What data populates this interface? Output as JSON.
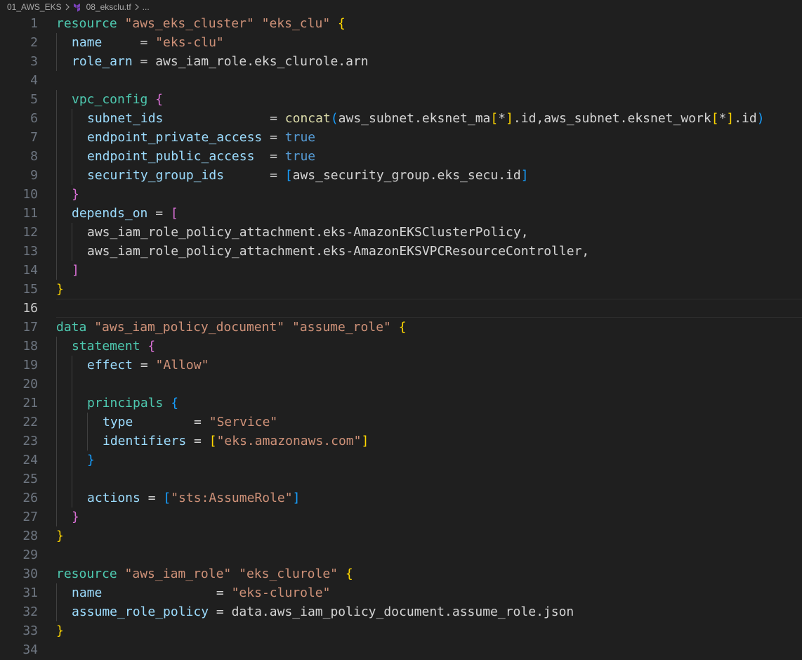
{
  "breadcrumb": {
    "folder": "01_AWS_EKS",
    "file": "08_eksclu.tf",
    "tail": "..."
  },
  "icons": {
    "separator": "chevron-right-icon",
    "file_icon": "terraform-icon"
  },
  "colors": {
    "background": "#1f1f1f",
    "keyword": "#4ec9b0",
    "string": "#ce9178",
    "attribute": "#9cdcfe",
    "boolean": "#569cd6",
    "function": "#dcdcaa",
    "bracket_level1": "#ffd700",
    "bracket_level2": "#da70d6",
    "bracket_level3": "#179fff"
  },
  "editor": {
    "current_line": 16,
    "lines": [
      {
        "n": "1",
        "indent": 0,
        "t": [
          [
            "kw",
            "resource"
          ],
          [
            "op",
            " "
          ],
          [
            "str",
            "\"aws_eks_cluster\""
          ],
          [
            "op",
            " "
          ],
          [
            "str",
            "\"eks_clu\""
          ],
          [
            "op",
            " "
          ],
          [
            "b1",
            "{"
          ]
        ]
      },
      {
        "n": "2",
        "indent": 1,
        "t": [
          [
            "attr",
            "name"
          ],
          [
            "op",
            "     = "
          ],
          [
            "str",
            "\"eks-clu\""
          ]
        ]
      },
      {
        "n": "3",
        "indent": 1,
        "t": [
          [
            "attr",
            "role_arn"
          ],
          [
            "op",
            " = aws_iam_role.eks_clurole.arn"
          ]
        ]
      },
      {
        "n": "4",
        "indent": 0,
        "t": []
      },
      {
        "n": "5",
        "indent": 1,
        "t": [
          [
            "kw",
            "vpc_config"
          ],
          [
            "op",
            " "
          ],
          [
            "b2",
            "{"
          ]
        ]
      },
      {
        "n": "6",
        "indent": 2,
        "t": [
          [
            "attr",
            "subnet_ids"
          ],
          [
            "op",
            "              = "
          ],
          [
            "fn",
            "concat"
          ],
          [
            "b3",
            "("
          ],
          [
            "op",
            "aws_subnet.eksnet_ma"
          ],
          [
            "b1",
            "["
          ],
          [
            "op",
            "*"
          ],
          [
            "b1",
            "]"
          ],
          [
            "op",
            ".id,aws_subnet.eksnet_work"
          ],
          [
            "b1",
            "["
          ],
          [
            "op",
            "*"
          ],
          [
            "b1",
            "]"
          ],
          [
            "op",
            ".id"
          ],
          [
            "b3",
            ")"
          ]
        ]
      },
      {
        "n": "7",
        "indent": 2,
        "t": [
          [
            "attr",
            "endpoint_private_access"
          ],
          [
            "op",
            " = "
          ],
          [
            "val",
            "true"
          ]
        ]
      },
      {
        "n": "8",
        "indent": 2,
        "t": [
          [
            "attr",
            "endpoint_public_access"
          ],
          [
            "op",
            "  = "
          ],
          [
            "val",
            "true"
          ]
        ]
      },
      {
        "n": "9",
        "indent": 2,
        "t": [
          [
            "attr",
            "security_group_ids"
          ],
          [
            "op",
            "      = "
          ],
          [
            "b3",
            "["
          ],
          [
            "op",
            "aws_security_group.eks_secu.id"
          ],
          [
            "b3",
            "]"
          ]
        ]
      },
      {
        "n": "10",
        "indent": 1,
        "t": [
          [
            "b2",
            "}"
          ]
        ]
      },
      {
        "n": "11",
        "indent": 1,
        "t": [
          [
            "attr",
            "depends_on"
          ],
          [
            "op",
            " = "
          ],
          [
            "b2",
            "["
          ]
        ]
      },
      {
        "n": "12",
        "indent": 2,
        "t": [
          [
            "op",
            "aws_iam_role_policy_attachment.eks-AmazonEKSClusterPolicy,"
          ]
        ]
      },
      {
        "n": "13",
        "indent": 2,
        "t": [
          [
            "op",
            "aws_iam_role_policy_attachment.eks-AmazonEKSVPCResourceController,"
          ]
        ]
      },
      {
        "n": "14",
        "indent": 1,
        "t": [
          [
            "b2",
            "]"
          ]
        ]
      },
      {
        "n": "15",
        "indent": 0,
        "t": [
          [
            "b1",
            "}"
          ]
        ]
      },
      {
        "n": "16",
        "indent": 0,
        "t": []
      },
      {
        "n": "17",
        "indent": 0,
        "t": [
          [
            "kw",
            "data"
          ],
          [
            "op",
            " "
          ],
          [
            "str",
            "\"aws_iam_policy_document\""
          ],
          [
            "op",
            " "
          ],
          [
            "str",
            "\"assume_role\""
          ],
          [
            "op",
            " "
          ],
          [
            "b1",
            "{"
          ]
        ]
      },
      {
        "n": "18",
        "indent": 1,
        "t": [
          [
            "kw",
            "statement"
          ],
          [
            "op",
            " "
          ],
          [
            "b2",
            "{"
          ]
        ]
      },
      {
        "n": "19",
        "indent": 2,
        "t": [
          [
            "attr",
            "effect"
          ],
          [
            "op",
            " = "
          ],
          [
            "str",
            "\"Allow\""
          ]
        ]
      },
      {
        "n": "20",
        "indent": 0,
        "guides": 2,
        "t": []
      },
      {
        "n": "21",
        "indent": 2,
        "t": [
          [
            "kw",
            "principals"
          ],
          [
            "op",
            " "
          ],
          [
            "b3",
            "{"
          ]
        ]
      },
      {
        "n": "22",
        "indent": 3,
        "t": [
          [
            "attr",
            "type"
          ],
          [
            "op",
            "        = "
          ],
          [
            "str",
            "\"Service\""
          ]
        ]
      },
      {
        "n": "23",
        "indent": 3,
        "t": [
          [
            "attr",
            "identifiers"
          ],
          [
            "op",
            " = "
          ],
          [
            "b1",
            "["
          ],
          [
            "str",
            "\"eks.amazonaws.com\""
          ],
          [
            "b1",
            "]"
          ]
        ]
      },
      {
        "n": "24",
        "indent": 2,
        "t": [
          [
            "b3",
            "}"
          ]
        ]
      },
      {
        "n": "25",
        "indent": 0,
        "guides": 2,
        "t": []
      },
      {
        "n": "26",
        "indent": 2,
        "t": [
          [
            "attr",
            "actions"
          ],
          [
            "op",
            " = "
          ],
          [
            "b3",
            "["
          ],
          [
            "str",
            "\"sts:AssumeRole\""
          ],
          [
            "b3",
            "]"
          ]
        ]
      },
      {
        "n": "27",
        "indent": 1,
        "t": [
          [
            "b2",
            "}"
          ]
        ]
      },
      {
        "n": "28",
        "indent": 0,
        "t": [
          [
            "b1",
            "}"
          ]
        ]
      },
      {
        "n": "29",
        "indent": 0,
        "t": []
      },
      {
        "n": "30",
        "indent": 0,
        "t": [
          [
            "kw",
            "resource"
          ],
          [
            "op",
            " "
          ],
          [
            "str",
            "\"aws_iam_role\""
          ],
          [
            "op",
            " "
          ],
          [
            "str",
            "\"eks_clurole\""
          ],
          [
            "op",
            " "
          ],
          [
            "b1",
            "{"
          ]
        ]
      },
      {
        "n": "31",
        "indent": 1,
        "t": [
          [
            "attr",
            "name"
          ],
          [
            "op",
            "               = "
          ],
          [
            "str",
            "\"eks-clurole\""
          ]
        ]
      },
      {
        "n": "32",
        "indent": 1,
        "t": [
          [
            "attr",
            "assume_role_policy"
          ],
          [
            "op",
            " = data.aws_iam_policy_document.assume_role.json"
          ]
        ]
      },
      {
        "n": "33",
        "indent": 0,
        "t": [
          [
            "b1",
            "}"
          ]
        ]
      },
      {
        "n": "34",
        "indent": 0,
        "t": []
      }
    ]
  }
}
